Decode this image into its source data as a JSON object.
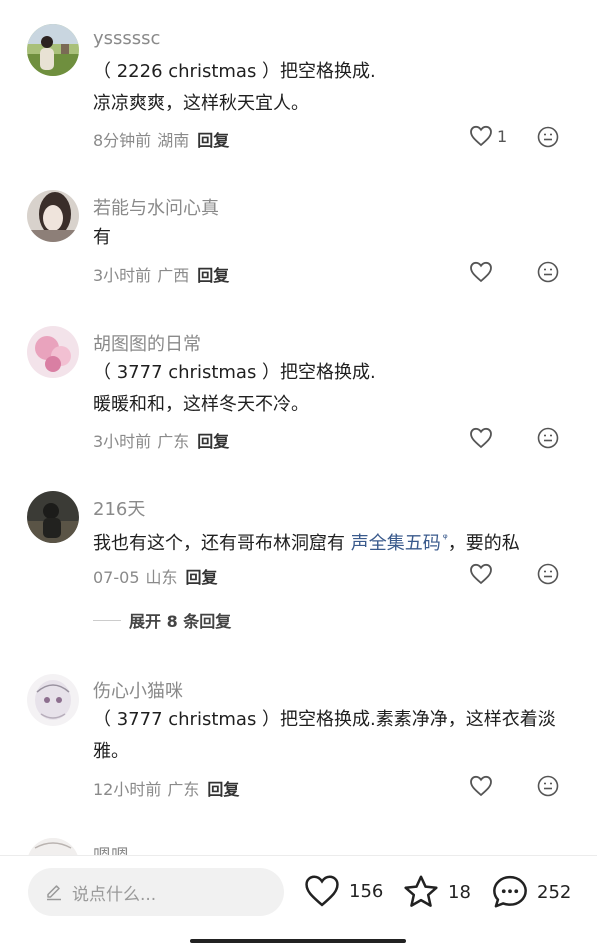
{
  "comments": [
    {
      "username": "ysssssc",
      "lines": [
        "（ 2226 christmas ）把空格换成.",
        "凉凉爽爽，这样秋天宜人。"
      ],
      "time": "8分钟前",
      "location": "湖南",
      "reply_label": "回复",
      "likes": "1"
    },
    {
      "username": "若能与水问心真",
      "lines": [
        "有"
      ],
      "time": "3小时前",
      "location": "广西",
      "reply_label": "回复",
      "likes": ""
    },
    {
      "username": "胡图图的日常",
      "lines": [
        "（ 3777 christmas ）把空格换成.",
        "暖暖和和，这样冬天不冷。"
      ],
      "time": "3小时前",
      "location": "广东",
      "reply_label": "回复",
      "likes": ""
    },
    {
      "username": "216天",
      "text_before": "我也有这个，还有哥布林洞窟有 ",
      "text_link": "声全集五码",
      "text_after": "，要的私",
      "time": "07-05",
      "location": "山东",
      "reply_label": "回复",
      "likes": ""
    },
    {
      "username": "伤心小猫咪",
      "lines": [
        "（ 3777 christmas ）把空格换成.素素净净，这样衣着淡",
        "雅。"
      ],
      "time": "12小时前",
      "location": "广东",
      "reply_label": "回复",
      "likes": ""
    },
    {
      "username": "嗯嗯"
    }
  ],
  "expand_replies": "展开 8 条回复",
  "bottom_bar": {
    "input_placeholder": "说点什么...",
    "likes": "156",
    "favorites": "18",
    "comments": "252"
  },
  "colors": {
    "link": "#3a5a8c",
    "meta_text": "#8a8a8a",
    "input_bg": "#f1f1f1"
  }
}
